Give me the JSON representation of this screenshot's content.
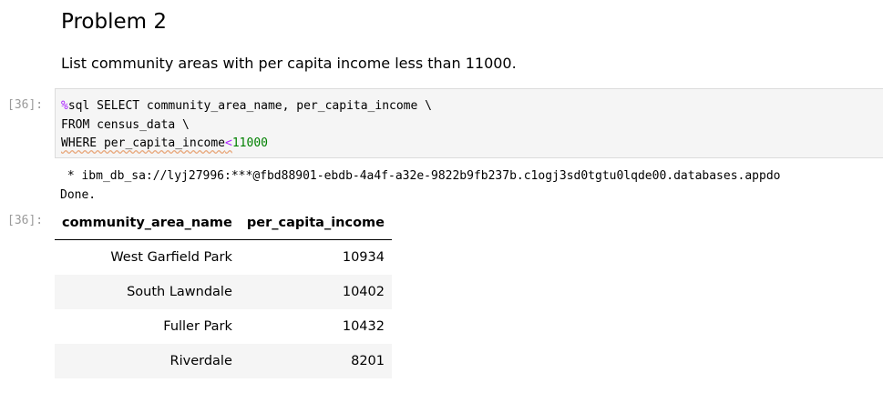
{
  "markdown": {
    "heading": "Problem 2",
    "paragraph": "List community areas with per capita income less than 11000."
  },
  "code_cell": {
    "prompt": "[36]:",
    "line1_magic": "%",
    "line1_rest": "sql SELECT community_area_name, per_capita_income \\",
    "line2": "FROM census_data \\",
    "line3_text": "WHERE per_capita_income",
    "line3_op": "<",
    "line3_num": "11000"
  },
  "output": {
    "prompt": "[36]:",
    "connection": " * ibm_db_sa://lyj27996:***@fbd88901-ebdb-4a4f-a32e-9822b9fb237b.c1ogj3sd0tgtu0lqde00.databases.appdo",
    "status": "Done.",
    "table": {
      "headers": [
        "community_area_name",
        "per_capita_income"
      ],
      "rows": [
        [
          "West Garfield Park",
          "10934"
        ],
        [
          "South Lawndale",
          "10402"
        ],
        [
          "Fuller Park",
          "10432"
        ],
        [
          "Riverdale",
          "8201"
        ]
      ]
    }
  }
}
